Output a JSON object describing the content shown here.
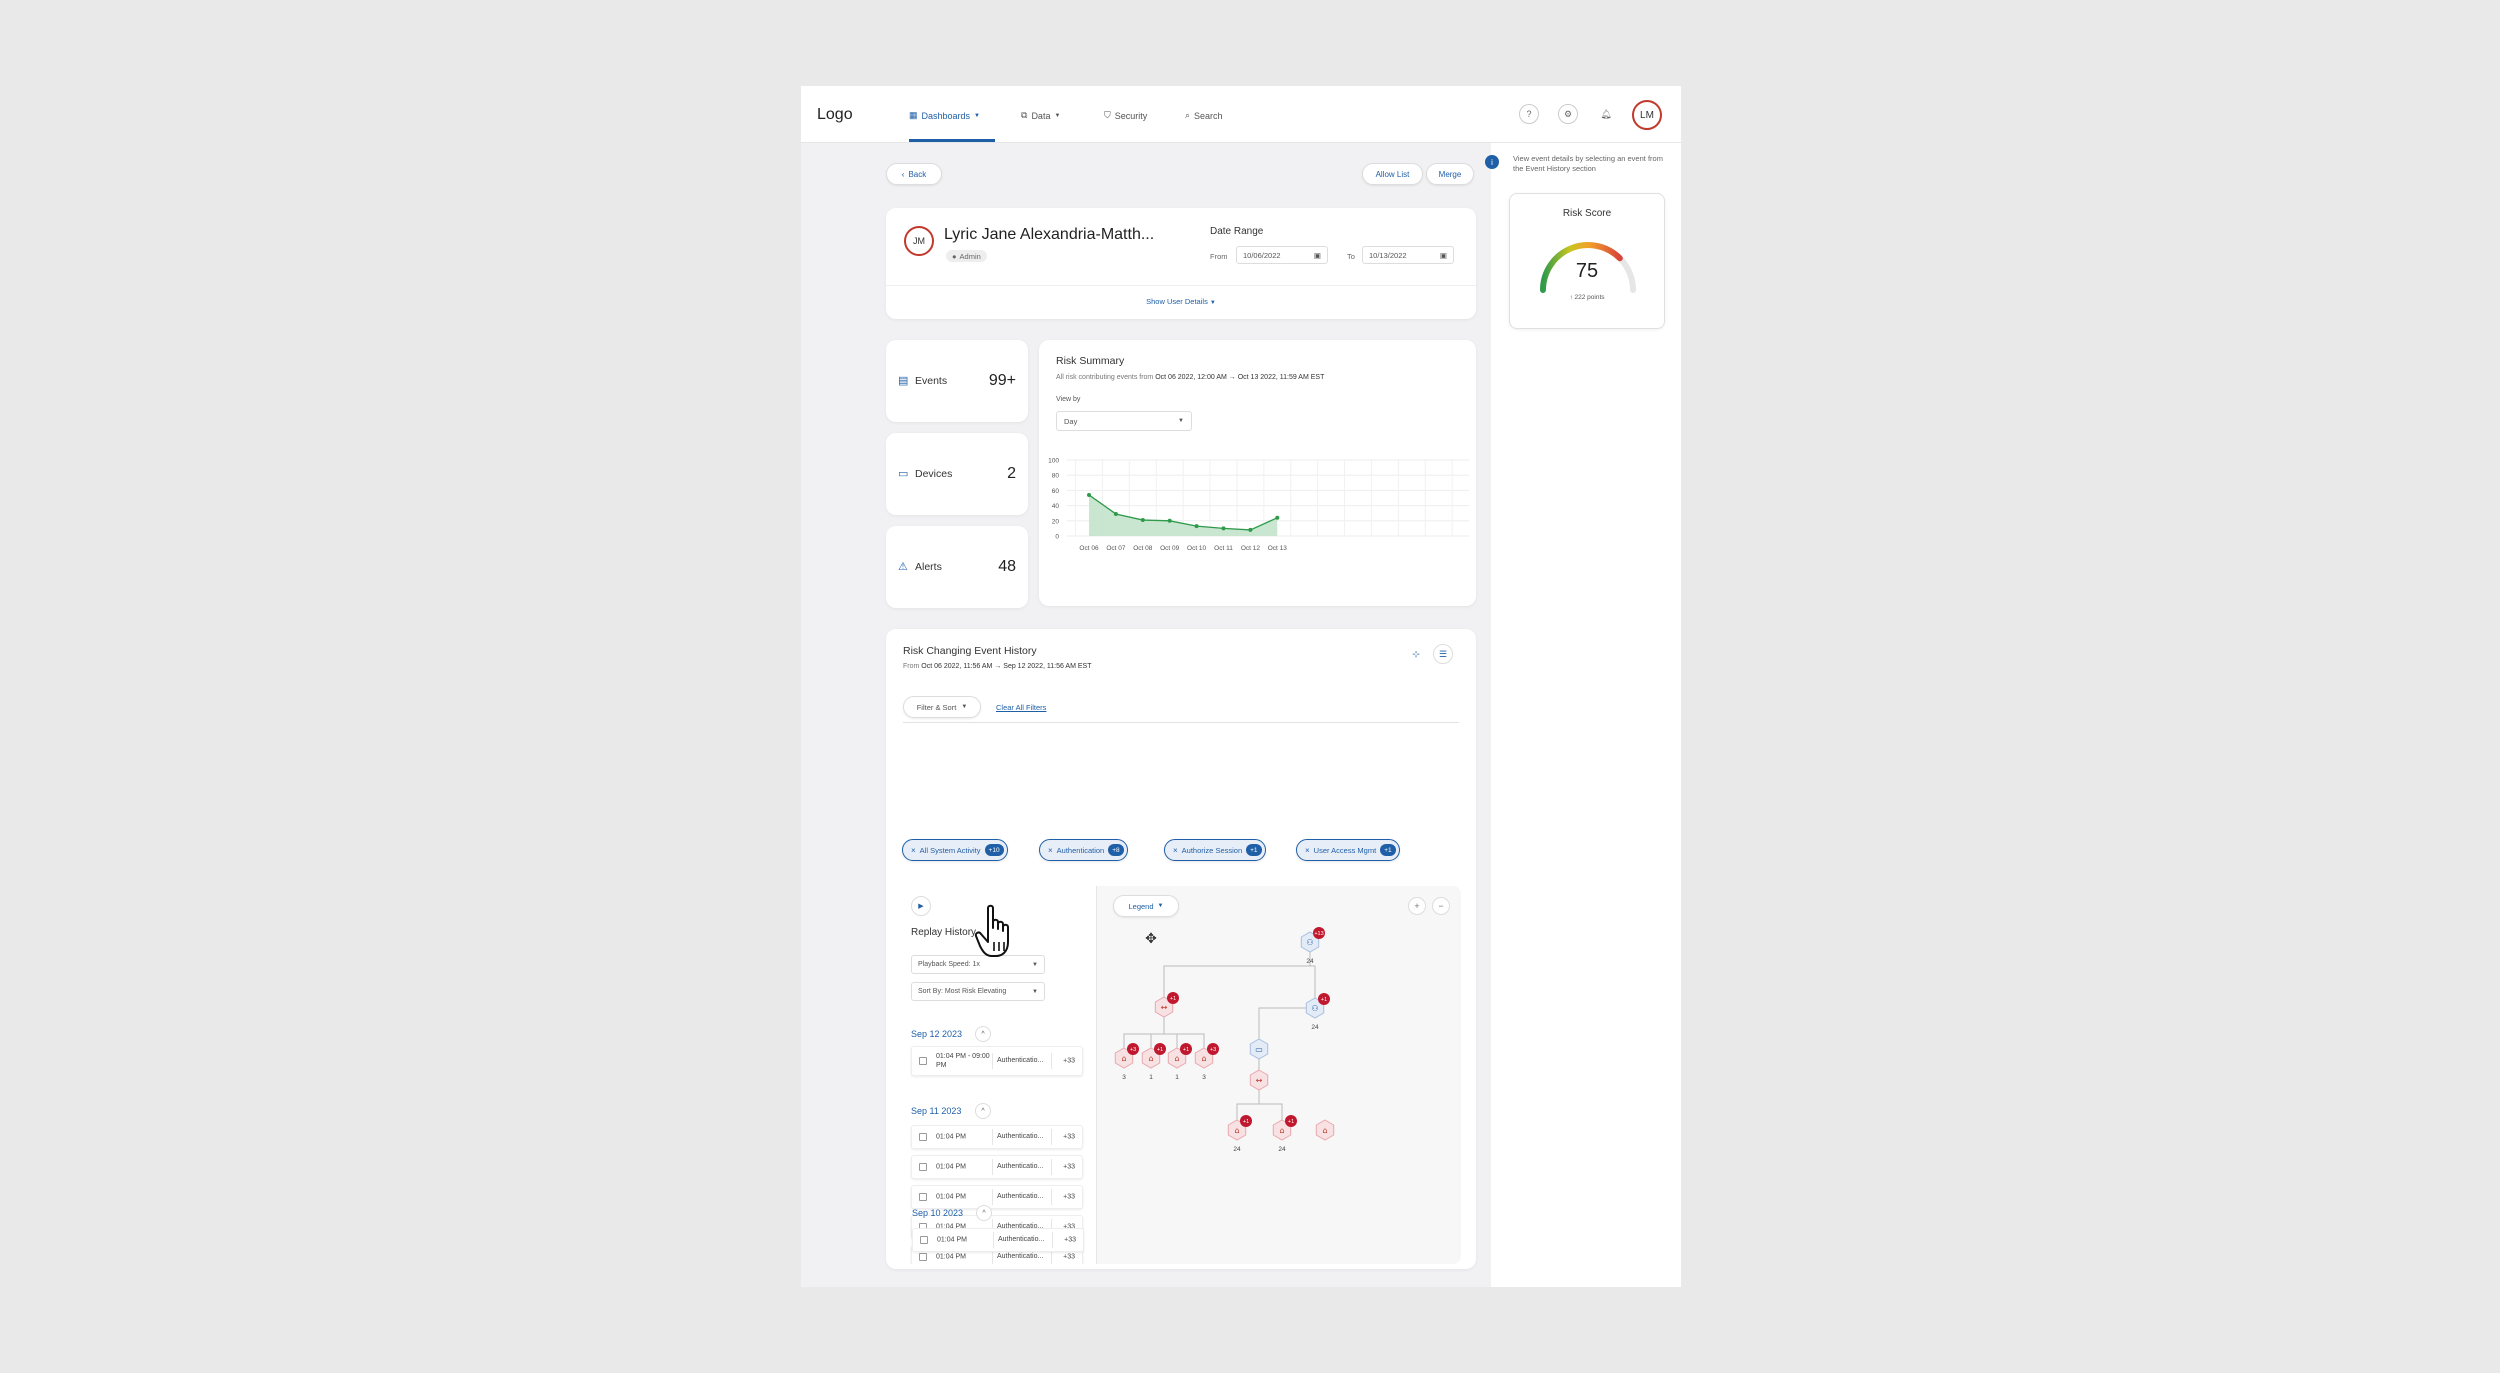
{
  "nav": {
    "logo": "Logo",
    "items": [
      {
        "label": "Dashboards",
        "icon": "grid-icon",
        "has_dropdown": true,
        "active": true
      },
      {
        "label": "Data",
        "icon": "copy-icon",
        "has_dropdown": true,
        "active": false
      },
      {
        "label": "Security",
        "icon": "shield-icon",
        "has_dropdown": false,
        "active": false
      },
      {
        "label": "Search",
        "icon": "search-icon",
        "has_dropdown": false,
        "active": false
      }
    ],
    "user_initials": "LM"
  },
  "toolbar": {
    "back_label": "Back",
    "allow_list_label": "Allow List",
    "merge_label": "Merge"
  },
  "user": {
    "initials": "JM",
    "name": "Lyric Jane Alexandria-Matth...",
    "role": "Admin",
    "date_range_title": "Date Range",
    "from_label": "From",
    "from_value": "10/06/2022",
    "to_label": "To",
    "to_value": "10/13/2022",
    "show_details": "Show User Details"
  },
  "stats": [
    {
      "label": "Events",
      "value": "99+",
      "icon": "calendar-icon"
    },
    {
      "label": "Devices",
      "value": "2",
      "icon": "devices-icon"
    },
    {
      "label": "Alerts",
      "value": "48",
      "icon": "warning-icon"
    }
  ],
  "risk_summary": {
    "title": "Risk Summary",
    "subtitle_prefix": "All risk contributing events from",
    "subtitle_range": "Oct 06 2022, 12:00 AM → Oct 13 2022, 11:59 AM EST",
    "view_by_label": "View by",
    "view_by_value": "Day"
  },
  "chart_data": {
    "type": "area",
    "categories": [
      "Oct 06",
      "Oct 07",
      "Oct 08",
      "Oct 09",
      "Oct 10",
      "Oct 11",
      "Oct 12",
      "Oct 13"
    ],
    "values": [
      54,
      29,
      21,
      20,
      13,
      10,
      8,
      24
    ],
    "ylim": [
      0,
      100
    ],
    "yticks": [
      0,
      20,
      40,
      60,
      80,
      100
    ],
    "line_color": "#2e9a4a",
    "fill_color": "#bfe3c8",
    "grid": true
  },
  "side_panel": {
    "info_text": "View event details by selecting an event from the Event History section",
    "risk_score_title": "Risk Score",
    "risk_score_value": "75",
    "risk_score_sub": "↑ 222 points",
    "risk_score_fraction": 0.75
  },
  "history": {
    "title": "Risk Changing Event History",
    "subtitle_prefix": "From",
    "subtitle_range": "Oct 06 2022, 11:56 AM → Sep 12 2022, 11:56 AM EST",
    "filter_label": "Filter & Sort",
    "clear_label": "Clear All Filters",
    "chips": [
      {
        "label": "All System Activity",
        "count": "+10"
      },
      {
        "label": "Authentication",
        "count": "+8"
      },
      {
        "label": "Authorize Session",
        "count": "+1"
      },
      {
        "label": "User Access Mgmt",
        "count": "+1"
      }
    ],
    "replay_title": "Replay History",
    "playback_label": "Playback Speed: 1x",
    "sort_label": "Sort By: Most Risk Elevating",
    "legend_label": "Legend",
    "groups": [
      {
        "date": "Sep 12 2023",
        "events": [
          {
            "time": "01:04 PM - 09:00 PM",
            "type": "Authenticatio...",
            "more": "+33"
          }
        ]
      },
      {
        "date": "Sep 11 2023",
        "events": [
          {
            "time": "01:04 PM",
            "type": "Authenticatio...",
            "more": "+33"
          },
          {
            "time": "01:04 PM",
            "type": "Authenticatio...",
            "more": "+33"
          },
          {
            "time": "01:04 PM",
            "type": "Authenticatio...",
            "more": "+33"
          },
          {
            "time": "01:04 PM",
            "type": "Authenticatio...",
            "more": "+33"
          },
          {
            "time": "01:04 PM",
            "type": "Authenticatio...",
            "more": "+33"
          }
        ]
      },
      {
        "date": "Sep 10 2023",
        "events": [
          {
            "time": "01:04 PM",
            "type": "Authenticatio...",
            "more": "+33"
          }
        ]
      }
    ],
    "graph_nodes": [
      {
        "id": "root",
        "kind": "user",
        "badge": "+13",
        "count": "24",
        "tone": "blue"
      },
      {
        "id": "n1",
        "kind": "session",
        "badge": "+1",
        "count": "",
        "tone": "red"
      },
      {
        "id": "n2",
        "kind": "user",
        "badge": "+1",
        "count": "24",
        "tone": "blue"
      },
      {
        "id": "l1",
        "kind": "device",
        "badge": "+3",
        "count": "3",
        "tone": "red"
      },
      {
        "id": "l2",
        "kind": "device",
        "badge": "+1",
        "count": "1",
        "tone": "red"
      },
      {
        "id": "l3",
        "kind": "device",
        "badge": "+1",
        "count": "1",
        "tone": "red"
      },
      {
        "id": "l4",
        "kind": "device",
        "badge": "+3",
        "count": "3",
        "tone": "red"
      },
      {
        "id": "m1",
        "kind": "monitor",
        "badge": "",
        "count": "",
        "tone": "blue"
      },
      {
        "id": "m2",
        "kind": "session",
        "badge": "",
        "count": "",
        "tone": "red"
      },
      {
        "id": "b1",
        "kind": "device",
        "badge": "+1",
        "count": "24",
        "tone": "red"
      },
      {
        "id": "b2",
        "kind": "device",
        "badge": "+1",
        "count": "24",
        "tone": "red"
      },
      {
        "id": "b3",
        "kind": "device",
        "badge": "",
        "count": "",
        "tone": "red"
      }
    ]
  }
}
